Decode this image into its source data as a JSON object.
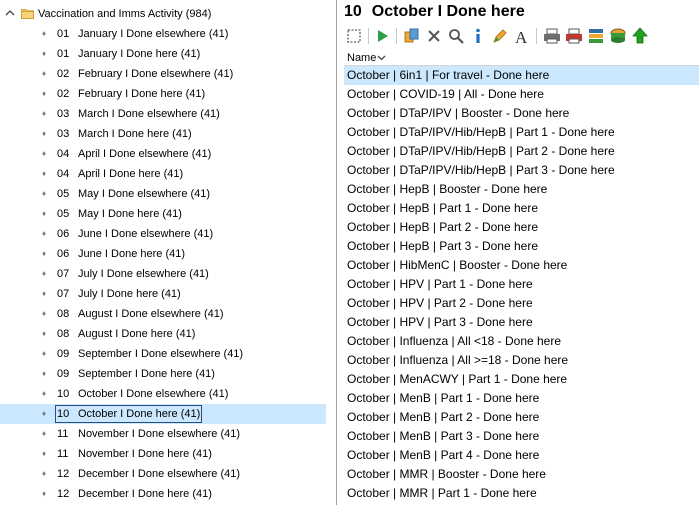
{
  "tree": {
    "root_label": "Vaccination and Imms Activity (984)",
    "items": [
      {
        "num": "01",
        "label": "January I Done elsewhere (41)"
      },
      {
        "num": "01",
        "label": "January I Done here (41)"
      },
      {
        "num": "02",
        "label": "February I Done elsewhere (41)"
      },
      {
        "num": "02",
        "label": "February I Done here (41)"
      },
      {
        "num": "03",
        "label": "March I Done elsewhere (41)"
      },
      {
        "num": "03",
        "label": "March I Done here (41)"
      },
      {
        "num": "04",
        "label": "April I Done elsewhere (41)"
      },
      {
        "num": "04",
        "label": "April I Done here (41)"
      },
      {
        "num": "05",
        "label": "May I Done elsewhere (41)"
      },
      {
        "num": "05",
        "label": "May I Done here (41)"
      },
      {
        "num": "06",
        "label": "June I Done elsewhere (41)"
      },
      {
        "num": "06",
        "label": "June I Done here (41)"
      },
      {
        "num": "07",
        "label": "July I Done elsewhere (41)"
      },
      {
        "num": "07",
        "label": "July I Done here (41)"
      },
      {
        "num": "08",
        "label": "August I Done elsewhere (41)"
      },
      {
        "num": "08",
        "label": "August I Done here (41)"
      },
      {
        "num": "09",
        "label": "September I Done elsewhere (41)"
      },
      {
        "num": "09",
        "label": "September I Done here (41)"
      },
      {
        "num": "10",
        "label": "October I Done elsewhere (41)"
      },
      {
        "num": "10",
        "label": "October I Done here (41)"
      },
      {
        "num": "11",
        "label": "November I Done elsewhere (41)"
      },
      {
        "num": "11",
        "label": "November I Done here (41)"
      },
      {
        "num": "12",
        "label": "December I Done elsewhere (41)"
      },
      {
        "num": "12",
        "label": "December I Done here (41)"
      }
    ]
  },
  "panel": {
    "number": "10",
    "title": "October I Done here"
  },
  "toolbar": {
    "icons": [
      "select-all-icon",
      "run-icon",
      "copy-icon",
      "delete-icon",
      "search-icon",
      "info-icon",
      "edit-icon",
      "font-icon",
      "print-icon",
      "print-preview-icon",
      "export-icon",
      "database-icon",
      "up-arrow-icon"
    ]
  },
  "list": {
    "column_name": "Name",
    "rows": [
      "October | 6in1 | For travel - Done here",
      "October | COVID-19 | All - Done here",
      "October | DTaP/IPV | Booster - Done here",
      "October | DTaP/IPV/Hib/HepB | Part 1 - Done here",
      "October | DTaP/IPV/Hib/HepB | Part 2 - Done here",
      "October | DTaP/IPV/Hib/HepB | Part 3 - Done here",
      "October | HepB | Booster - Done here",
      "October | HepB | Part 1 - Done here",
      "October | HepB | Part 2 - Done here",
      "October | HepB | Part 3 - Done here",
      "October | HibMenC | Booster - Done here",
      "October | HPV | Part 1 - Done here",
      "October | HPV | Part 2 - Done here",
      "October | HPV | Part 3 - Done here",
      "October | Influenza | All <18 - Done here",
      "October | Influenza | All >=18 - Done here",
      "October | MenACWY | Part 1 - Done here",
      "October | MenB | Part 1 - Done here",
      "October | MenB | Part 2 - Done here",
      "October | MenB | Part 3 - Done here",
      "October | MenB | Part 4 - Done here",
      "October | MMR | Booster - Done here",
      "October | MMR | Part 1 - Done here"
    ]
  },
  "colors": {
    "selection": "#cce8ff",
    "folder": "#e8b84a",
    "run_green": "#2ea043"
  }
}
